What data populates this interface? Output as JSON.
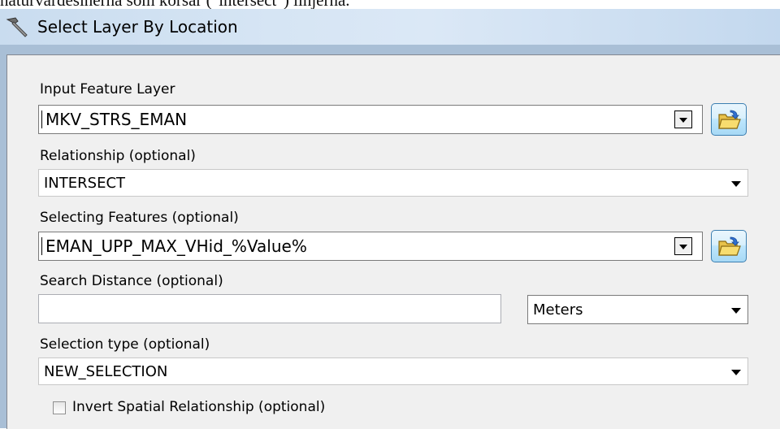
{
  "background_caption": "naturvärdesinerna som korsar (\"intersect\") linjerna.",
  "window": {
    "title": "Select Layer By Location",
    "title_icon": "hammer-tool-icon"
  },
  "form": {
    "input_feature_layer": {
      "label": "Input Feature Layer",
      "value": "MKV_STRS_EMAN",
      "browse_icon": "open-folder-icon"
    },
    "relationship": {
      "label": "Relationship (optional)",
      "value": "INTERSECT"
    },
    "selecting_features": {
      "label": "Selecting Features (optional)",
      "value": "EMAN_UPP_MAX_VHid_%Value%",
      "browse_icon": "open-folder-icon"
    },
    "search_distance": {
      "label": "Search Distance (optional)",
      "value": "",
      "unit": "Meters"
    },
    "selection_type": {
      "label": "Selection type (optional)",
      "value": "NEW_SELECTION"
    },
    "invert_spatial_relationship": {
      "label": "Invert Spatial Relationship (optional)",
      "checked": false
    }
  },
  "colors": {
    "titlebar": "#d6e5f4",
    "panel": "#f0f0f0",
    "frame": "#a9bfd6"
  }
}
